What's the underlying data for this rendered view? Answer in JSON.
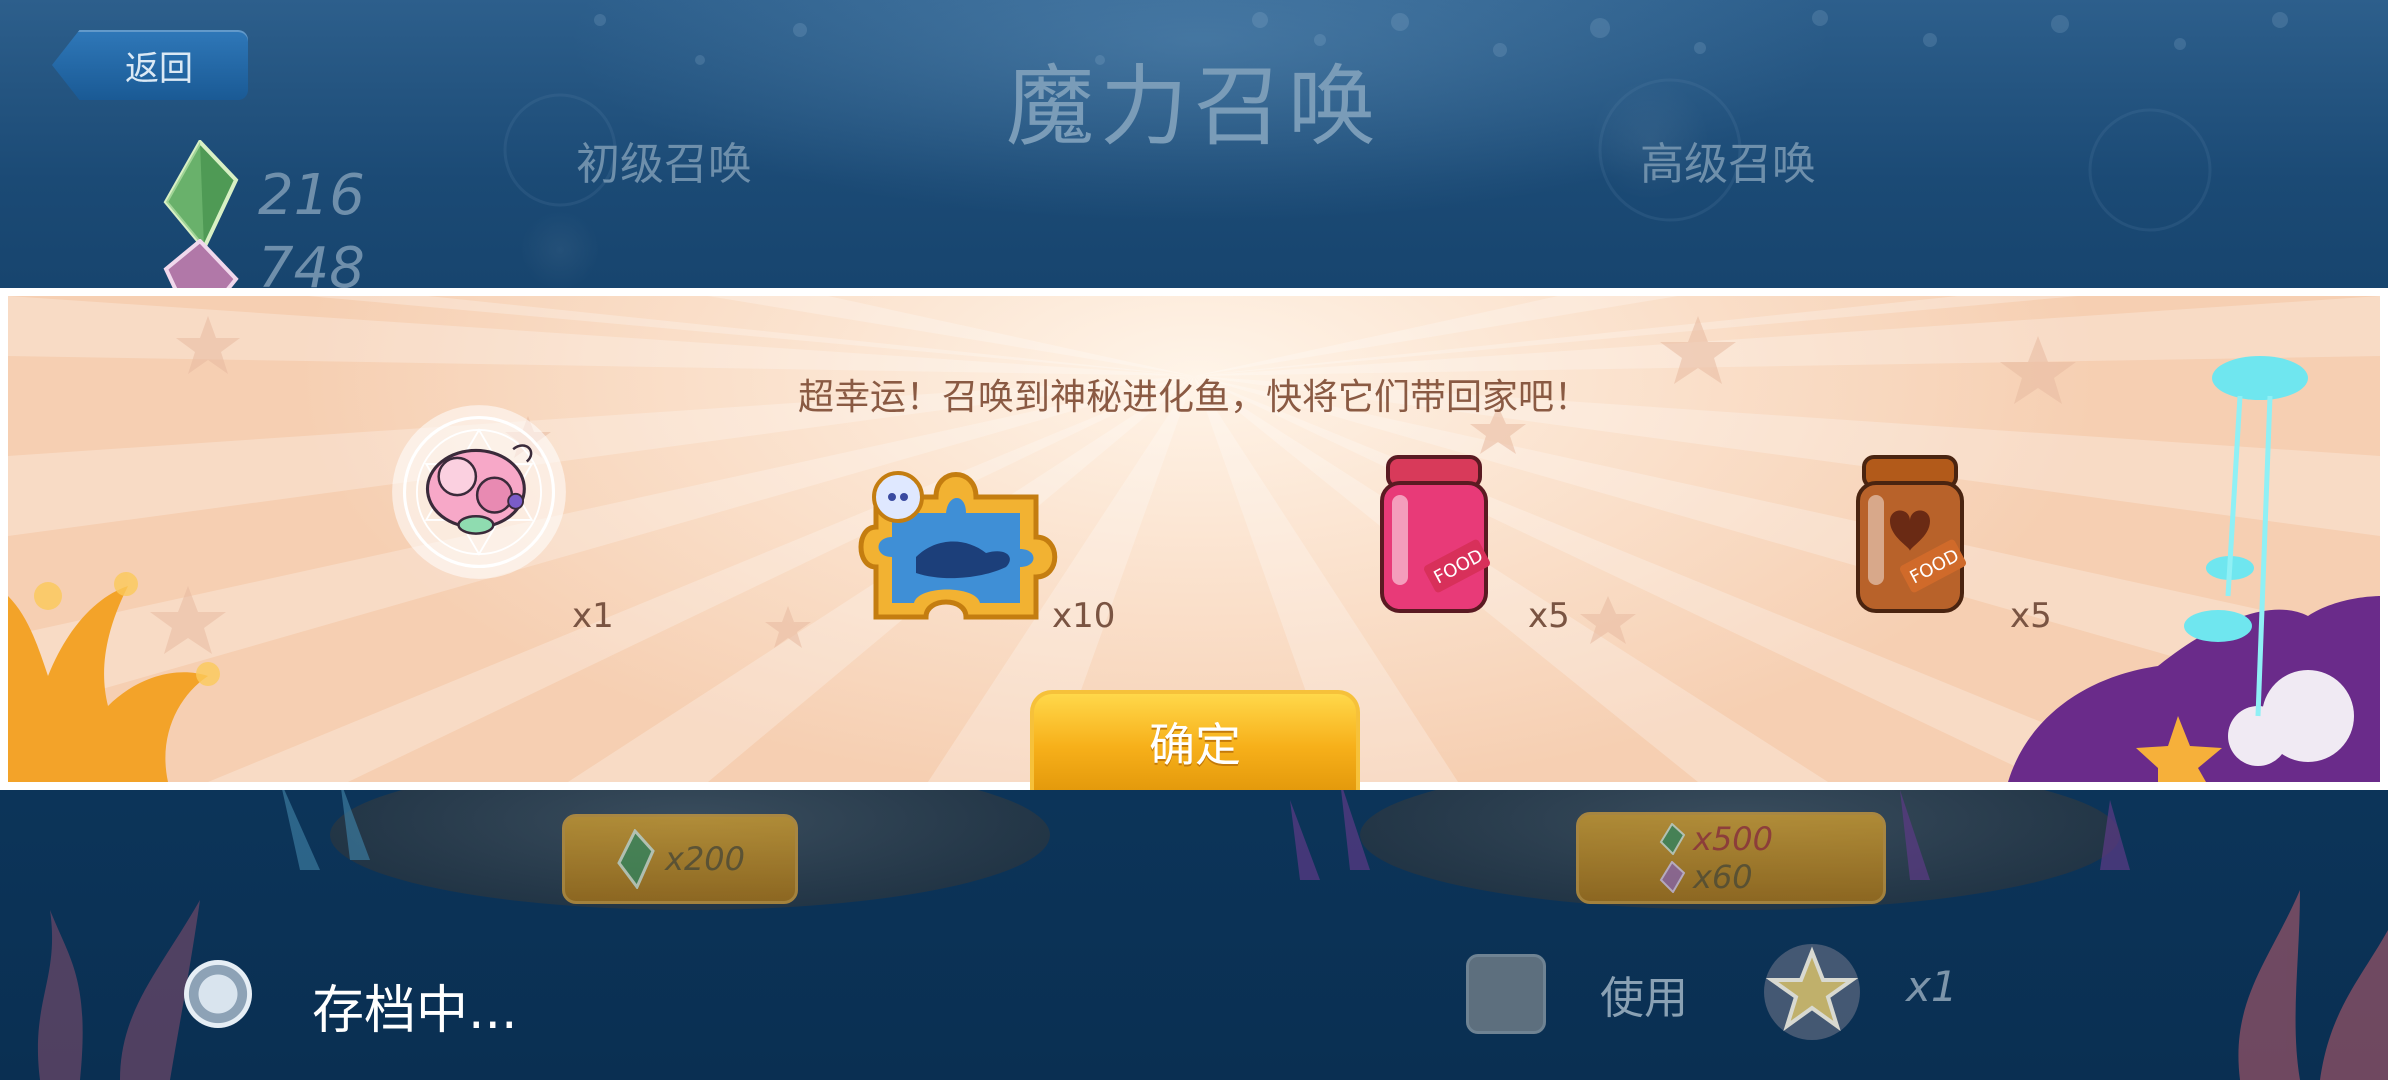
{
  "header": {
    "back_label": "返回",
    "title": "魔力召唤",
    "tab_basic": "初级召唤",
    "tab_advanced": "高级召唤"
  },
  "currencies": [
    {
      "icon": "green-crystal-icon",
      "value": "216"
    },
    {
      "icon": "purple-crystal-icon",
      "value": "748"
    }
  ],
  "popup": {
    "message": "超幸运！召唤到神秘进化鱼，快将它们带回家吧！",
    "rewards": [
      {
        "icon": "pink-fish-icon",
        "qty": "x1"
      },
      {
        "icon": "fish-puzzle-piece-icon",
        "qty": "x10"
      },
      {
        "icon": "pink-food-jar-icon",
        "qty": "x5"
      },
      {
        "icon": "brown-food-jar-icon",
        "qty": "x5"
      }
    ],
    "confirm_label": "确定",
    "jar_label": "FOOD"
  },
  "summon_costs": {
    "basic": "x200",
    "advanced_green": "x500",
    "advanced_purple": "x60"
  },
  "footer": {
    "saving_text": "存档中...",
    "use_label": "使用",
    "item_qty": "x1"
  },
  "colors": {
    "accent_orange": "#f7b01a",
    "popup_text": "#8a5a43",
    "background": "#0e3b63"
  }
}
